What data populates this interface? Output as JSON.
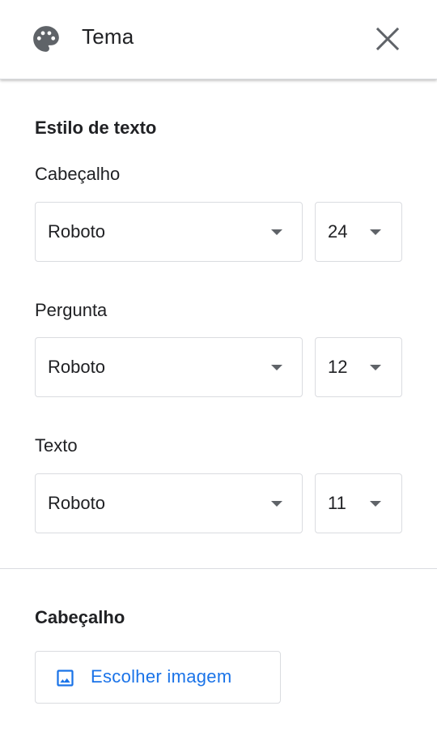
{
  "header": {
    "title": "Tema",
    "palette_icon": "palette-icon",
    "close_icon": "close-icon"
  },
  "text_style": {
    "section_title": "Estilo de texto",
    "rows": [
      {
        "label": "Cabeçalho",
        "font": "Roboto",
        "size": "24"
      },
      {
        "label": "Pergunta",
        "font": "Roboto",
        "size": "12"
      },
      {
        "label": "Texto",
        "font": "Roboto",
        "size": "11"
      }
    ]
  },
  "header_image": {
    "section_title": "Cabeçalho",
    "button_label": "Escolher imagem",
    "button_icon": "image-icon"
  },
  "colors": {
    "accent": "#1a73e8",
    "icon_gray": "#5f6368",
    "border": "#dadce0",
    "text": "#202124"
  }
}
